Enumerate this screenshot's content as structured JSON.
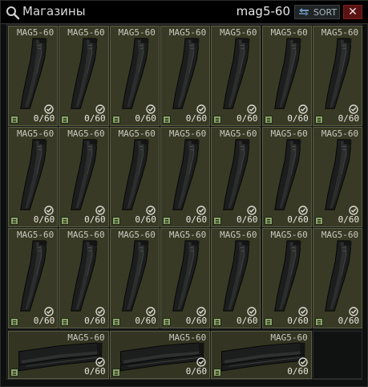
{
  "window": {
    "title": "Магазины",
    "search_value": "mag5-60",
    "sort_label": "SORT",
    "close_label": "✕"
  },
  "icons": {
    "search": "search-icon",
    "sort": "sort-icon",
    "doc": "document-icon",
    "check": "checkmark-icon",
    "magazine": "magazine-icon"
  },
  "colors": {
    "cell_bg": "#383a25",
    "cell_border": "#5b5e45",
    "close_bg": "#5a1313",
    "sort_text": "#a8b6c0"
  },
  "items": [
    {
      "name": "MAG5-60",
      "count": "0/60",
      "orientation": "vertical"
    },
    {
      "name": "MAG5-60",
      "count": "0/60",
      "orientation": "vertical"
    },
    {
      "name": "MAG5-60",
      "count": "0/60",
      "orientation": "vertical"
    },
    {
      "name": "MAG5-60",
      "count": "0/60",
      "orientation": "vertical"
    },
    {
      "name": "MAG5-60",
      "count": "0/60",
      "orientation": "vertical"
    },
    {
      "name": "MAG5-60",
      "count": "0/60",
      "orientation": "vertical"
    },
    {
      "name": "MAG5-60",
      "count": "0/60",
      "orientation": "vertical"
    },
    {
      "name": "MAG5-60",
      "count": "0/60",
      "orientation": "vertical"
    },
    {
      "name": "MAG5-60",
      "count": "0/60",
      "orientation": "vertical"
    },
    {
      "name": "MAG5-60",
      "count": "0/60",
      "orientation": "vertical"
    },
    {
      "name": "MAG5-60",
      "count": "0/60",
      "orientation": "vertical"
    },
    {
      "name": "MAG5-60",
      "count": "0/60",
      "orientation": "vertical"
    },
    {
      "name": "MAG5-60",
      "count": "0/60",
      "orientation": "vertical"
    },
    {
      "name": "MAG5-60",
      "count": "0/60",
      "orientation": "vertical"
    },
    {
      "name": "MAG5-60",
      "count": "0/60",
      "orientation": "vertical"
    },
    {
      "name": "MAG5-60",
      "count": "0/60",
      "orientation": "vertical"
    },
    {
      "name": "MAG5-60",
      "count": "0/60",
      "orientation": "vertical"
    },
    {
      "name": "MAG5-60",
      "count": "0/60",
      "orientation": "vertical"
    },
    {
      "name": "MAG5-60",
      "count": "0/60",
      "orientation": "vertical"
    },
    {
      "name": "MAG5-60",
      "count": "0/60",
      "orientation": "vertical"
    },
    {
      "name": "MAG5-60",
      "count": "0/60",
      "orientation": "vertical"
    },
    {
      "name": "MAG5-60",
      "count": "0/60",
      "orientation": "horizontal"
    },
    {
      "name": "MAG5-60",
      "count": "0/60",
      "orientation": "horizontal"
    },
    {
      "name": "MAG5-60",
      "count": "0/60",
      "orientation": "horizontal"
    }
  ]
}
